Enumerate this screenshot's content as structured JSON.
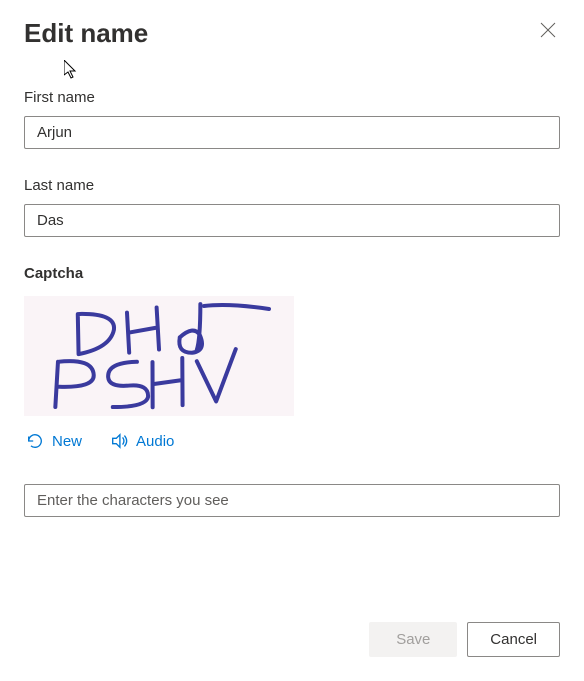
{
  "dialog": {
    "title": "Edit name"
  },
  "fields": {
    "firstName": {
      "label": "First name",
      "value": "Arjun"
    },
    "lastName": {
      "label": "Last name",
      "value": "Das"
    }
  },
  "captcha": {
    "heading": "Captcha",
    "imageText": "DHd PSHV",
    "newLabel": "New",
    "audioLabel": "Audio",
    "inputPlaceholder": "Enter the characters you see",
    "inputValue": ""
  },
  "buttons": {
    "save": "Save",
    "cancel": "Cancel"
  },
  "colors": {
    "link": "#0078d4",
    "text": "#323130",
    "border": "#8a8886",
    "disabledBg": "#f3f2f1",
    "disabledText": "#a19f9d",
    "captchaBg": "#faf4f7",
    "captchaInk": "#3a3a9e"
  }
}
